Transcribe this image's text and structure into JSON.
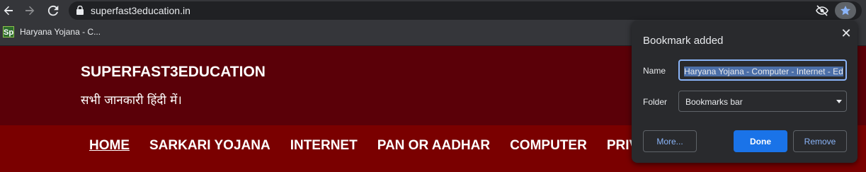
{
  "browser": {
    "url": "superfast3education.in",
    "bookmark_label": "Haryana Yojana - C...",
    "favicon_text": "Sp",
    "icons": [
      "back-arrow-icon",
      "forward-arrow-icon",
      "reload-icon",
      "lock-icon",
      "eye-off-icon",
      "star-icon"
    ]
  },
  "site": {
    "title": "SUPERFAST3EDUCATION",
    "tagline": "सभी जानकारी हिंदी में।",
    "menu": [
      {
        "label": "HOME",
        "active": true
      },
      {
        "label": "SARKARI YOJANA"
      },
      {
        "label": "INTERNET"
      },
      {
        "label": "PAN OR AADHAR"
      },
      {
        "label": "COMPUTER"
      },
      {
        "label": "PRIVA"
      }
    ]
  },
  "popup": {
    "title": "Bookmark added",
    "name_label": "Name",
    "name_value": "Haryana Yojana - Computer - Internet - Ed",
    "folder_label": "Folder",
    "folder_value": "Bookmarks bar",
    "more_label": "More...",
    "done_label": "Done",
    "remove_label": "Remove",
    "close_glyph": "✕"
  },
  "colors": {
    "accent": "#1a73e8",
    "site_header": "#5a0008",
    "site_nav": "#7a0000"
  }
}
